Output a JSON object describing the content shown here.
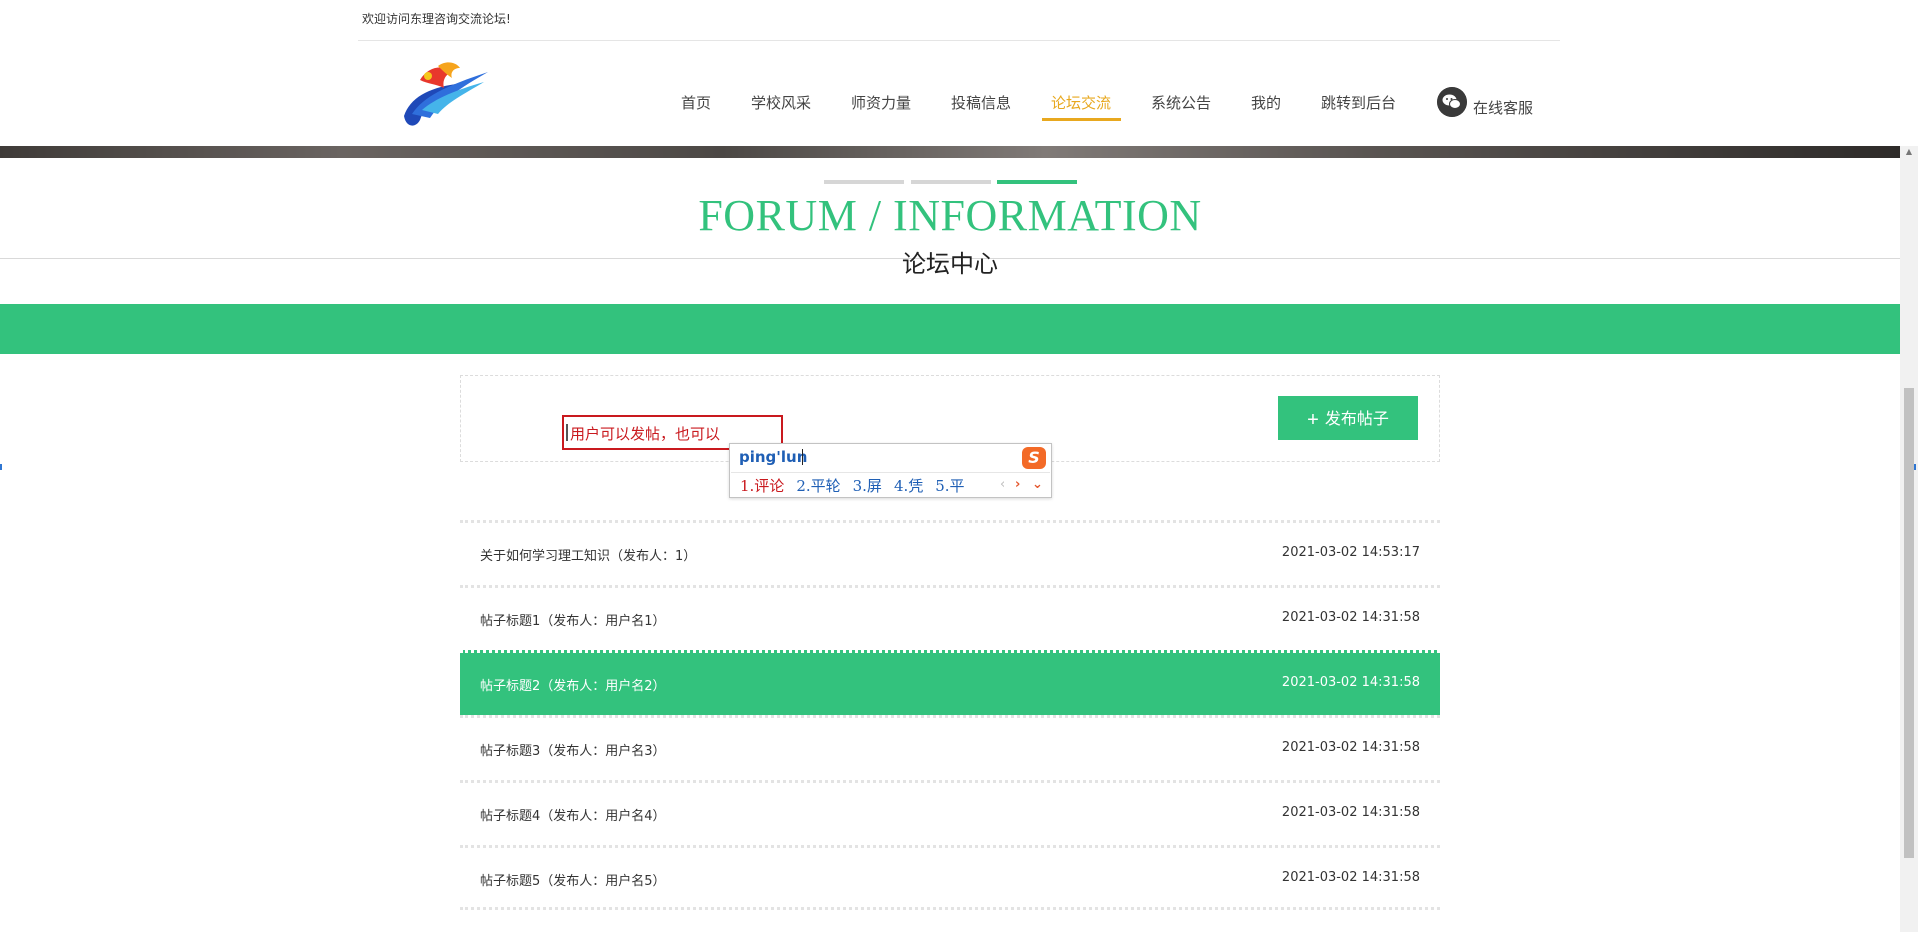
{
  "header": {
    "welcome": "欢迎访问东理咨询交流论坛!",
    "nav": [
      {
        "label": "首页",
        "active": false
      },
      {
        "label": "学校风采",
        "active": false
      },
      {
        "label": "师资力量",
        "active": false
      },
      {
        "label": "投稿信息",
        "active": false
      },
      {
        "label": "论坛交流",
        "active": true
      },
      {
        "label": "系统公告",
        "active": false
      },
      {
        "label": "我的",
        "active": false
      },
      {
        "label": "跳转到后台",
        "active": false
      }
    ],
    "service_label": "在线客服",
    "accent_color": "#e8a81f"
  },
  "section": {
    "title_en": "FORUM / INFORMATION",
    "title_cn": "论坛中心",
    "accent_color": "#33c27d"
  },
  "post": {
    "input_value": "用户可以发帖，也可以",
    "button_label": "发布帖子",
    "button_icon": "plus-icon"
  },
  "ime": {
    "pinyin": "ping'lun",
    "candidates": [
      "1.评论",
      "2.平轮",
      "3.屏",
      "4.凭",
      "5.平"
    ],
    "prev_glyph": "‹",
    "next_glyph": "›",
    "more_glyph": "⌄",
    "logo_glyph": "S"
  },
  "posts": [
    {
      "title": "关于如何学习理工知识（发布人：1）",
      "time": "2021-03-02 14:53:17",
      "active": false
    },
    {
      "title": "帖子标题1（发布人：用户名1）",
      "time": "2021-03-02 14:31:58",
      "active": false
    },
    {
      "title": "帖子标题2（发布人：用户名2）",
      "time": "2021-03-02 14:31:58",
      "active": true
    },
    {
      "title": "帖子标题3（发布人：用户名3）",
      "time": "2021-03-02 14:31:58",
      "active": false
    },
    {
      "title": "帖子标题4（发布人：用户名4）",
      "time": "2021-03-02 14:31:58",
      "active": false
    },
    {
      "title": "帖子标题5（发布人：用户名5）",
      "time": "2021-03-02 14:31:58",
      "active": false
    }
  ]
}
